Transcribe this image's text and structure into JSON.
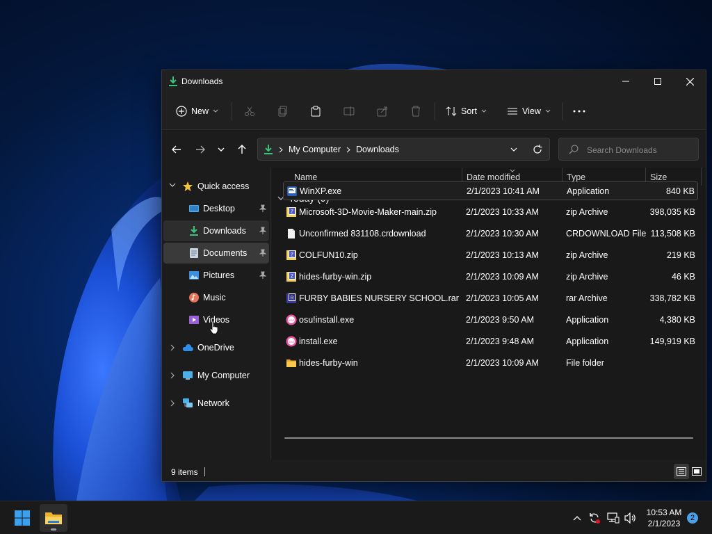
{
  "window": {
    "title": "Downloads",
    "controls": {
      "minimize": "minimize-icon",
      "maximize": "maximize-icon",
      "close": "close-icon"
    }
  },
  "toolbar": {
    "new_label": "New",
    "sort_label": "Sort",
    "view_label": "View"
  },
  "address": {
    "crumbs": [
      "My Computer",
      "Downloads"
    ],
    "search_placeholder": "Search Downloads"
  },
  "sidebar": {
    "quick_access": "Quick access",
    "items": [
      {
        "label": "Desktop",
        "icon": "desktop-icon",
        "pinned": true
      },
      {
        "label": "Downloads",
        "icon": "download-icon",
        "pinned": true
      },
      {
        "label": "Documents",
        "icon": "document-icon",
        "pinned": true
      },
      {
        "label": "Pictures",
        "icon": "picture-icon",
        "pinned": true
      },
      {
        "label": "Music",
        "icon": "music-icon",
        "pinned": false
      },
      {
        "label": "Videos",
        "icon": "video-icon",
        "pinned": false
      }
    ],
    "roots": [
      {
        "label": "OneDrive",
        "icon": "cloud-icon"
      },
      {
        "label": "My Computer",
        "icon": "computer-icon"
      },
      {
        "label": "Network",
        "icon": "network-icon"
      }
    ]
  },
  "columns": {
    "name": "Name",
    "date": "Date modified",
    "type": "Type",
    "size": "Size"
  },
  "group": {
    "label": "Today (9)"
  },
  "files": [
    {
      "name": "WinXP.exe",
      "date": "2/1/2023 10:41 AM",
      "type": "Application",
      "size": "840 KB",
      "icon": "exe-icon"
    },
    {
      "name": "Microsoft-3D-Movie-Maker-main.zip",
      "date": "2/1/2023 10:33 AM",
      "type": "zip Archive",
      "size": "398,035 KB",
      "icon": "zip-icon"
    },
    {
      "name": "Unconfirmed 831108.crdownload",
      "date": "2/1/2023 10:30 AM",
      "type": "CRDOWNLOAD File",
      "size": "113,508 KB",
      "icon": "file-icon"
    },
    {
      "name": "COLFUN10.zip",
      "date": "2/1/2023 10:13 AM",
      "type": "zip Archive",
      "size": "219 KB",
      "icon": "zip-icon"
    },
    {
      "name": "hides-furby-win.zip",
      "date": "2/1/2023 10:09 AM",
      "type": "zip Archive",
      "size": "46 KB",
      "icon": "zip-icon"
    },
    {
      "name": "FURBY BABIES NURSERY SCHOOL.rar",
      "date": "2/1/2023 10:05 AM",
      "type": "rar Archive",
      "size": "338,782 KB",
      "icon": "rar-icon"
    },
    {
      "name": "osu!install.exe",
      "date": "2/1/2023 9:50 AM",
      "type": "Application",
      "size": "4,380 KB",
      "icon": "osu-icon"
    },
    {
      "name": "install.exe",
      "date": "2/1/2023 9:48 AM",
      "type": "Application",
      "size": "149,919 KB",
      "icon": "osu-icon"
    },
    {
      "name": "hides-furby-win",
      "date": "2/1/2023 10:09 AM",
      "type": "File folder",
      "size": "",
      "icon": "folder-icon"
    }
  ],
  "status": {
    "count": "9 items"
  },
  "taskbar": {
    "time": "10:53 AM",
    "date": "2/1/2023",
    "notifications": "2"
  }
}
